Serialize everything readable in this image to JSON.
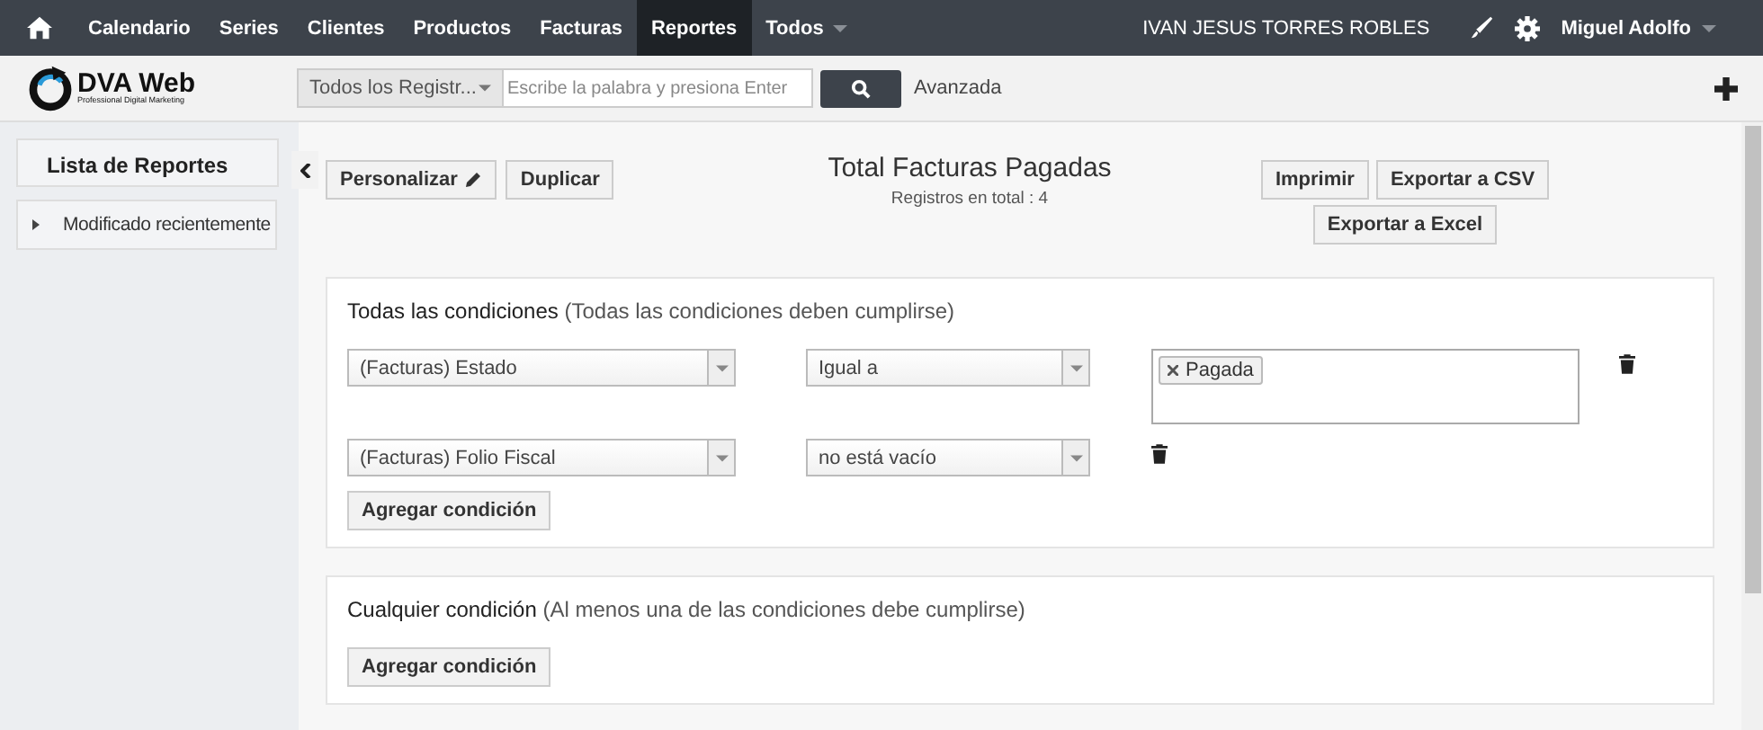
{
  "nav": {
    "items": [
      {
        "label": "Calendario",
        "selected": false,
        "dropdown": false
      },
      {
        "label": "Series",
        "selected": false,
        "dropdown": false
      },
      {
        "label": "Clientes",
        "selected": false,
        "dropdown": false
      },
      {
        "label": "Productos",
        "selected": false,
        "dropdown": false
      },
      {
        "label": "Facturas",
        "selected": false,
        "dropdown": false
      },
      {
        "label": "Reportes",
        "selected": true,
        "dropdown": false
      },
      {
        "label": "Todos",
        "selected": false,
        "dropdown": true
      }
    ],
    "company": "IVAN JESUS TORRES ROBLES",
    "user": "Miguel Adolfo"
  },
  "header": {
    "logo": "DVA Web",
    "logo_tagline": "Professional Digital Marketing",
    "search_scope": "Todos los Registr...",
    "search": {
      "placeholder": "Escribe la palabra y presiona Enter"
    },
    "advanced": "Avanzada"
  },
  "sidebar": {
    "title": "Lista de Reportes",
    "items": [
      {
        "label": "Modificado recientemente"
      }
    ]
  },
  "report": {
    "buttons": [
      "Personalizar",
      "Duplicar"
    ],
    "title": "Total Facturas Pagadas",
    "subtitle": "Registros en total : 4",
    "export_buttons": [
      "Imprimir",
      "Exportar a CSV",
      "Exportar a Excel"
    ]
  },
  "groups": [
    {
      "title": "Todas las condiciones",
      "hint": "(Todas las condiciones deben cumplirse)",
      "add_button": "Agregar condición",
      "conditions": [
        {
          "kind": "tags",
          "field": "(Facturas) Estado",
          "operator": "Igual a",
          "tags": [
            "Pagada"
          ]
        },
        {
          "kind": "unary",
          "field": "(Facturas) Folio Fiscal",
          "operator": "no está vacío"
        }
      ]
    },
    {
      "title": "Cualquier condición",
      "hint": "(Al menos una de las condiciones debe cumplirse)",
      "add_button": "Agregar condición"
    }
  ]
}
